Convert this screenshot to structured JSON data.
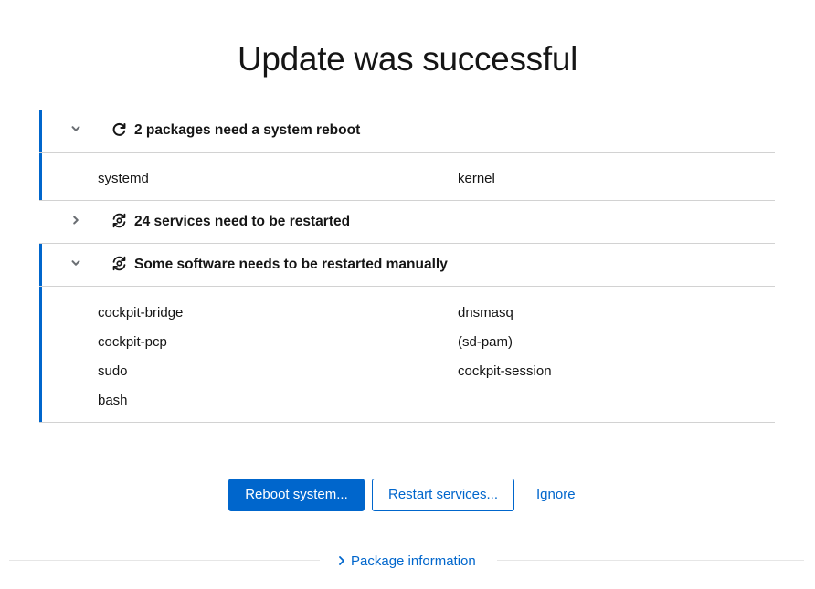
{
  "title": "Update was successful",
  "sections": [
    {
      "header": "2 packages need a system reboot",
      "expanded": true,
      "icon": "reboot-icon",
      "items": [
        "systemd",
        "kernel"
      ]
    },
    {
      "header": "24 services need to be restarted",
      "expanded": false,
      "icon": "restart-services-icon",
      "items": []
    },
    {
      "header": "Some software needs to be restarted manually",
      "expanded": true,
      "icon": "restart-manually-icon",
      "items": [
        "cockpit-bridge",
        "dnsmasq",
        "cockpit-pcp",
        "(sd-pam)",
        "sudo",
        "cockpit-session",
        "bash"
      ]
    }
  ],
  "actions": {
    "reboot_label": "Reboot system...",
    "restart_label": "Restart services...",
    "ignore_label": "Ignore"
  },
  "package_info_label": "Package information",
  "colors": {
    "accent": "#0066cc",
    "border": "#d2d2d2",
    "text": "#151515"
  }
}
